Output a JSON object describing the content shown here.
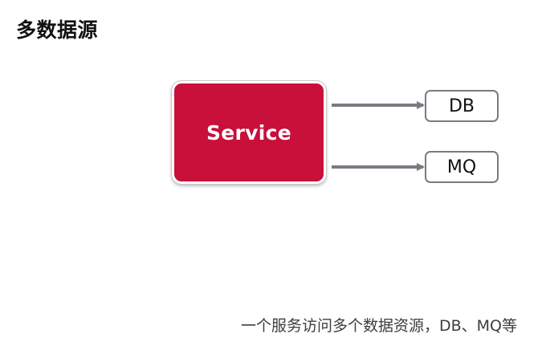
{
  "title": "多数据源",
  "diagram": {
    "source": {
      "label": "Service"
    },
    "targets": [
      {
        "label": "DB"
      },
      {
        "label": "MQ"
      }
    ]
  },
  "caption": "一个服务访问多个数据资源，DB、MQ等",
  "colors": {
    "service_fill": "#c8103a",
    "arrow": "#7a7a82",
    "target_border": "#7a7a82",
    "title_text": "#111111"
  }
}
